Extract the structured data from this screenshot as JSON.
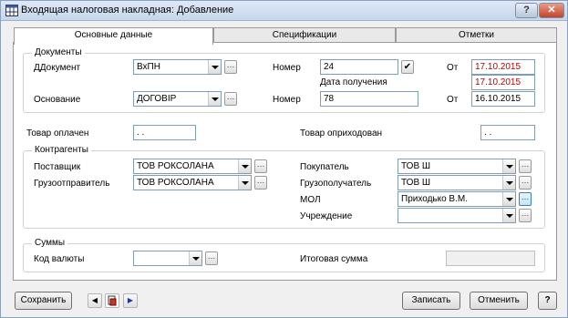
{
  "window": {
    "title": "Входящая налоговая накладная: Добавление",
    "help_label": "?",
    "close_label": "✕"
  },
  "tabs": [
    {
      "label": "Основные данные",
      "active": true
    },
    {
      "label": "Спецификации",
      "active": false
    },
    {
      "label": "Отметки",
      "active": false
    }
  ],
  "documents": {
    "group_title": "Документы",
    "document_label": "Документ",
    "document_value": "ВхПН",
    "number_label": "Номер",
    "number_value": "24",
    "from_label": "От",
    "from_value": "17.10.2015",
    "receipt_date_label": "Дата получения",
    "receipt_date_value": "17.10.2015",
    "basis_label": "Основание",
    "basis_value": "ДОГОВІР",
    "basis_number_label": "Номер",
    "basis_number_value": "78",
    "basis_from_label": "От",
    "basis_from_value": "16.10.2015"
  },
  "payment": {
    "paid_label": "Товар оплачен",
    "paid_value": ". .",
    "received_label": "Товар оприходован",
    "received_value": ". ."
  },
  "contractors": {
    "group_title": "Контрагенты",
    "supplier_label": "Поставщик",
    "supplier_value": "ТОВ РОКСОЛАНА",
    "shipper_label": "Грузоотправитель",
    "shipper_value": "ТОВ РОКСОЛАНА",
    "buyer_label": "Покупатель",
    "buyer_value": "ТОВ Ш",
    "consignee_label": "Грузополучатель",
    "consignee_value": "ТОВ Ш",
    "mol_label": "МОЛ",
    "mol_value": "Приходько В.М.",
    "institution_label": "Учреждение",
    "institution_value": ""
  },
  "sums": {
    "group_title": "Суммы",
    "currency_label": "Код валюты",
    "currency_value": "",
    "total_label": "Итоговая сумма",
    "total_value": ""
  },
  "footer": {
    "save_label": "Сохранить",
    "write_label": "Записать",
    "cancel_label": "Отменить",
    "help_label": "?"
  },
  "icons": {
    "app": "app-table-icon",
    "nav_prev": "arrow-left-icon",
    "nav_doc": "document-red-icon",
    "nav_next": "arrow-right-icon",
    "ellipsis": "ellipsis-icon",
    "dropdown": "chevron-down-icon",
    "check": "checkmark-icon"
  },
  "colors": {
    "date_red": "#c00000",
    "title_gradient_top": "#dfe9f6",
    "close_red": "#c2432a"
  }
}
